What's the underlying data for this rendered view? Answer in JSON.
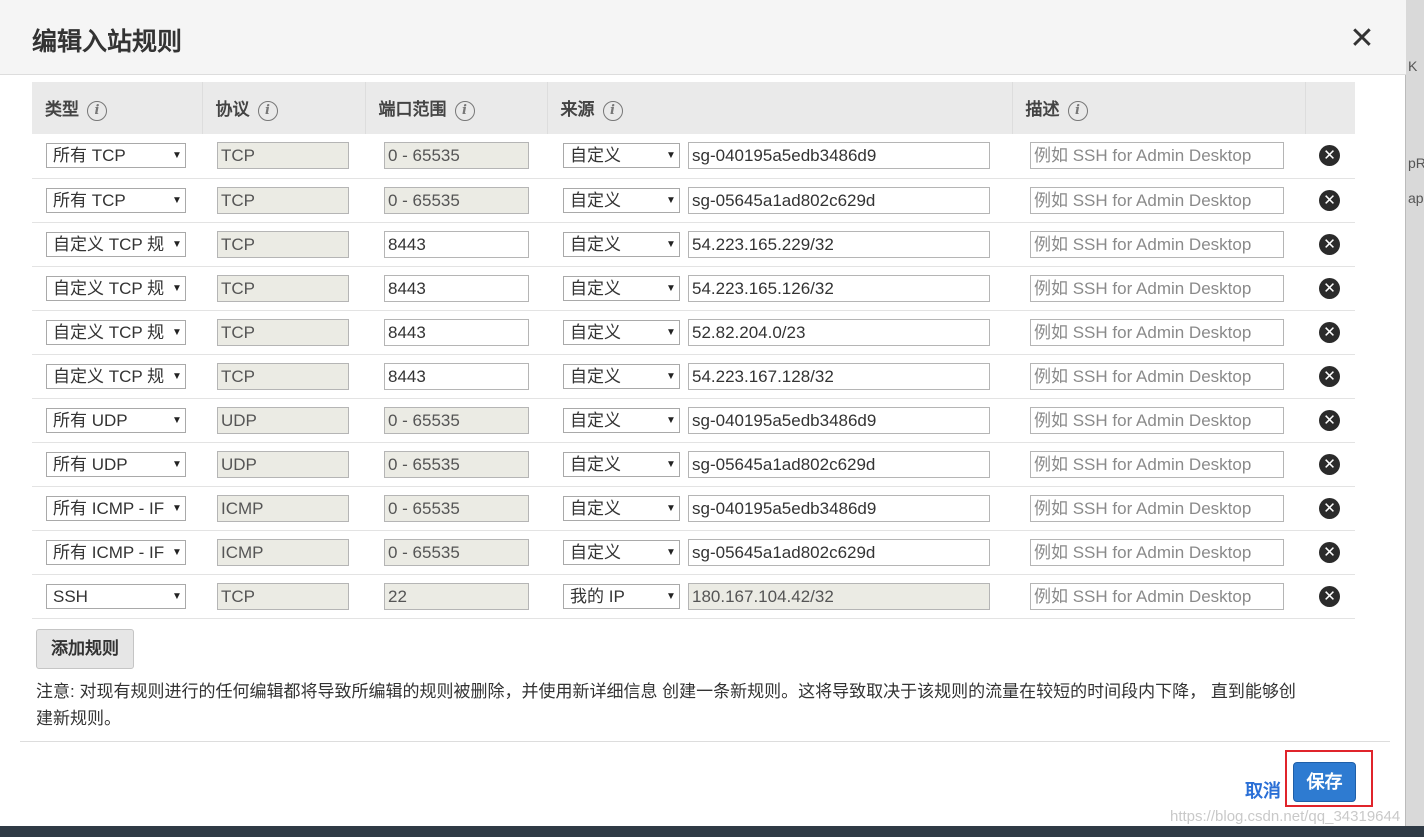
{
  "modal": {
    "title": "编辑入站规则",
    "close_glyph": "✕"
  },
  "columns": {
    "type": "类型",
    "protocol": "协议",
    "port_range": "端口范围",
    "source": "来源",
    "description": "描述"
  },
  "info_glyph": "i",
  "rules": [
    {
      "type": "所有 TCP",
      "protocol": "TCP",
      "port": "0 - 65535",
      "port_readonly": true,
      "source_mode": "自定义",
      "source": "sg-040195a5edb3486d9",
      "source_readonly": false,
      "desc_placeholder": "例如 SSH for Admin Desktop"
    },
    {
      "type": "所有 TCP",
      "protocol": "TCP",
      "port": "0 - 65535",
      "port_readonly": true,
      "source_mode": "自定义",
      "source": "sg-05645a1ad802c629d",
      "source_readonly": false,
      "desc_placeholder": "例如 SSH for Admin Desktop"
    },
    {
      "type": "自定义 TCP 规",
      "protocol": "TCP",
      "port": "8443",
      "port_readonly": false,
      "source_mode": "自定义",
      "source": "54.223.165.229/32",
      "source_readonly": false,
      "desc_placeholder": "例如 SSH for Admin Desktop"
    },
    {
      "type": "自定义 TCP 规",
      "protocol": "TCP",
      "port": "8443",
      "port_readonly": false,
      "source_mode": "自定义",
      "source": "54.223.165.126/32",
      "source_readonly": false,
      "desc_placeholder": "例如 SSH for Admin Desktop"
    },
    {
      "type": "自定义 TCP 规",
      "protocol": "TCP",
      "port": "8443",
      "port_readonly": false,
      "source_mode": "自定义",
      "source": "52.82.204.0/23",
      "source_readonly": false,
      "desc_placeholder": "例如 SSH for Admin Desktop"
    },
    {
      "type": "自定义 TCP 规",
      "protocol": "TCP",
      "port": "8443",
      "port_readonly": false,
      "source_mode": "自定义",
      "source": "54.223.167.128/32",
      "source_readonly": false,
      "desc_placeholder": "例如 SSH for Admin Desktop"
    },
    {
      "type": "所有 UDP",
      "protocol": "UDP",
      "port": "0 - 65535",
      "port_readonly": true,
      "source_mode": "自定义",
      "source": "sg-040195a5edb3486d9",
      "source_readonly": false,
      "desc_placeholder": "例如 SSH for Admin Desktop"
    },
    {
      "type": "所有 UDP",
      "protocol": "UDP",
      "port": "0 - 65535",
      "port_readonly": true,
      "source_mode": "自定义",
      "source": "sg-05645a1ad802c629d",
      "source_readonly": false,
      "desc_placeholder": "例如 SSH for Admin Desktop"
    },
    {
      "type": "所有 ICMP - IF",
      "protocol": "ICMP",
      "port": "0 - 65535",
      "port_readonly": true,
      "source_mode": "自定义",
      "source": "sg-040195a5edb3486d9",
      "source_readonly": false,
      "desc_placeholder": "例如 SSH for Admin Desktop"
    },
    {
      "type": "所有 ICMP - IF",
      "protocol": "ICMP",
      "port": "0 - 65535",
      "port_readonly": true,
      "source_mode": "自定义",
      "source": "sg-05645a1ad802c629d",
      "source_readonly": false,
      "desc_placeholder": "例如 SSH for Admin Desktop"
    },
    {
      "type": "SSH",
      "protocol": "TCP",
      "port": "22",
      "port_readonly": true,
      "source_mode": "我的 IP",
      "source": "180.167.104.42/32",
      "source_readonly": true,
      "desc_placeholder": "例如 SSH for Admin Desktop"
    }
  ],
  "remove_glyph": "✕",
  "dropdown_glyph": "▼",
  "add_rule_label": "添加规则",
  "note_text": "注意: 对现有规则进行的任何编辑都将导致所编辑的规则被删除，并使用新详细信息 创建一条新规则。这将导致取决于该规则的流量在较短的时间段内下降， 直到能够创建新规则。",
  "footer": {
    "cancel_label": "取消",
    "save_label": "保存"
  },
  "background_fragments": [
    "K",
    "pR",
    "ap"
  ],
  "watermark": "https://blog.csdn.net/qq_34319644",
  "colors": {
    "primary_button": "#2e7bd1",
    "link": "#2a6fd6",
    "highlight_box": "#e0242b",
    "header_bg": "#eaeaea"
  }
}
